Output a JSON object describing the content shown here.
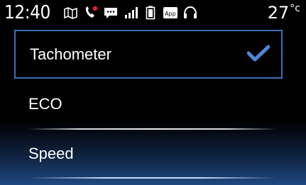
{
  "status_bar": {
    "time": "12:40",
    "temperature": "27",
    "temperature_unit": "°c",
    "icons": [
      "map-icon",
      "phone-missed-icon",
      "message-icon",
      "signal-icon",
      "battery-icon",
      "app-icon",
      "headset-icon"
    ],
    "app_icon_text": "App"
  },
  "menu": {
    "items": [
      {
        "label": "Tachometer",
        "selected": true
      },
      {
        "label": "ECO",
        "selected": false
      },
      {
        "label": "Speed",
        "selected": false
      }
    ],
    "accent_color": "#3b6fb6",
    "check_color": "#4f86d6"
  }
}
